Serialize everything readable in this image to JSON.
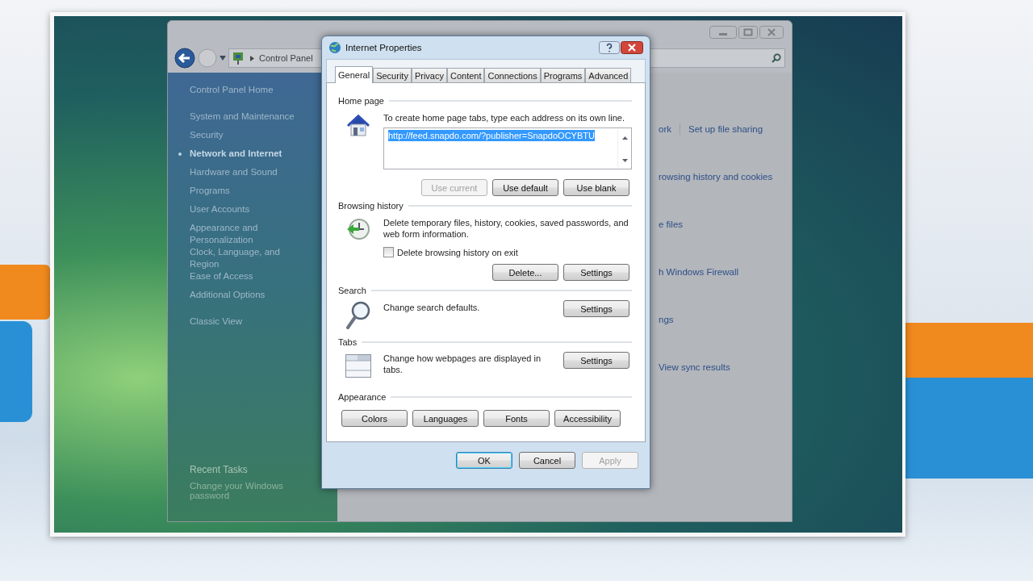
{
  "control_panel": {
    "breadcrumb": "Control Panel",
    "sidebar": {
      "groups": [
        {
          "items": [
            {
              "label": "Control Panel Home",
              "selected": false
            }
          ]
        },
        {
          "items": [
            {
              "label": "System and Maintenance",
              "selected": false
            },
            {
              "label": "Security",
              "selected": false
            },
            {
              "label": "Network and Internet",
              "selected": true
            },
            {
              "label": "Hardware and Sound",
              "selected": false
            },
            {
              "label": "Programs",
              "selected": false
            },
            {
              "label": "User Accounts",
              "selected": false
            },
            {
              "label": "Appearance and Personalization",
              "selected": false
            },
            {
              "label": "Clock, Language, and Region",
              "selected": false
            },
            {
              "label": "Ease of Access",
              "selected": false
            },
            {
              "label": "Additional Options",
              "selected": false
            }
          ]
        },
        {
          "items": [
            {
              "label": "Classic View",
              "selected": false
            }
          ]
        }
      ],
      "recent_tasks": {
        "title": "Recent Tasks",
        "items": [
          "Change your Windows password"
        ]
      }
    },
    "content_links": [
      [
        "ork",
        "Set up file sharing"
      ],
      [
        "rowsing history and cookies"
      ],
      [
        "e files"
      ],
      [
        "h Windows Firewall"
      ],
      [
        "ngs"
      ],
      [
        "View sync results"
      ]
    ]
  },
  "dialog": {
    "title": "Internet Properties",
    "tabs": [
      {
        "label": "General",
        "selected": true
      },
      {
        "label": "Security",
        "selected": false
      },
      {
        "label": "Privacy",
        "selected": false
      },
      {
        "label": "Content",
        "selected": false
      },
      {
        "label": "Connections",
        "selected": false
      },
      {
        "label": "Programs",
        "selected": false
      },
      {
        "label": "Advanced",
        "selected": false
      }
    ],
    "sections": [
      {
        "kind": "home",
        "heading": "Home page",
        "description": "To create home page tabs, type each address on its own line.",
        "field": {
          "value": "http://feed.snapdo.com/?publisher=SnapdoOCYBTU",
          "selected": true
        },
        "buttons": [
          {
            "label": "Use current",
            "disabled": true
          },
          {
            "label": "Use default",
            "disabled": false
          },
          {
            "label": "Use blank",
            "disabled": false
          }
        ]
      },
      {
        "kind": "history",
        "heading": "Browsing history",
        "description": "Delete temporary files, history, cookies, saved passwords, and web form information.",
        "checkbox": {
          "label": "Delete browsing history on exit",
          "checked": false
        },
        "buttons": [
          {
            "label": "Delete...",
            "disabled": false
          },
          {
            "label": "Settings",
            "disabled": false
          }
        ]
      },
      {
        "kind": "search",
        "heading": "Search",
        "description": "Change search defaults.",
        "buttons": [
          {
            "label": "Settings",
            "disabled": false
          }
        ]
      },
      {
        "kind": "tabs",
        "heading": "Tabs",
        "description": "Change how webpages are displayed in tabs.",
        "buttons": [
          {
            "label": "Settings",
            "disabled": false
          }
        ]
      },
      {
        "kind": "appearance",
        "heading": "Appearance",
        "buttons": [
          {
            "label": "Colors",
            "disabled": false
          },
          {
            "label": "Languages",
            "disabled": false
          },
          {
            "label": "Fonts",
            "disabled": false
          },
          {
            "label": "Accessibility",
            "disabled": false
          }
        ]
      }
    ],
    "footer_buttons": [
      {
        "label": "OK",
        "disabled": false,
        "default": true
      },
      {
        "label": "Cancel",
        "disabled": false,
        "default": false
      },
      {
        "label": "Apply",
        "disabled": true,
        "default": false
      }
    ]
  }
}
